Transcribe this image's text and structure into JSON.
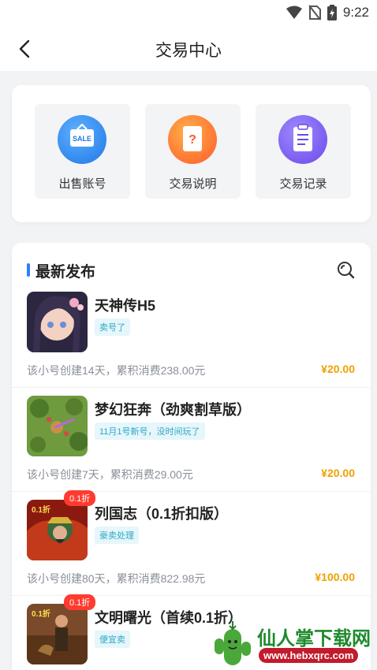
{
  "status": {
    "time": "9:22"
  },
  "header": {
    "title": "交易中心"
  },
  "actions": [
    {
      "label": "出售账号",
      "icon": "sale-icon",
      "badge": "SALE",
      "color": "#2e8bf0"
    },
    {
      "label": "交易说明",
      "icon": "question-doc-icon",
      "badge": "?",
      "color": "#ff7a2e"
    },
    {
      "label": "交易记录",
      "icon": "clipboard-icon",
      "color": "#7a5cf0"
    }
  ],
  "list": {
    "title": "最新发布",
    "items": [
      {
        "name": "天神传H5",
        "note": "卖号了",
        "meta": "该小号创建14天，累积消费238.00元",
        "price": "¥20.00"
      },
      {
        "name": "梦幻狂奔（劲爽割草版）",
        "note": "11月1号新号，没时间玩了",
        "meta": "该小号创建7天，累积消费29.00元",
        "price": "¥20.00"
      },
      {
        "name": "列国志（0.1折扣版）",
        "note": "豪卖处理",
        "meta": "该小号创建80天，累积消费822.98元",
        "price": "¥100.00",
        "discount": "0.1折",
        "cover_text": "0.1折"
      },
      {
        "name": "文明曙光（首续0.1折）",
        "note": "便宜卖",
        "meta": "",
        "price": "",
        "discount": "0.1折",
        "cover_text": "0.1折"
      }
    ]
  },
  "watermark": {
    "title": "仙人掌下载网",
    "url": "www.hebxqrc.com"
  }
}
